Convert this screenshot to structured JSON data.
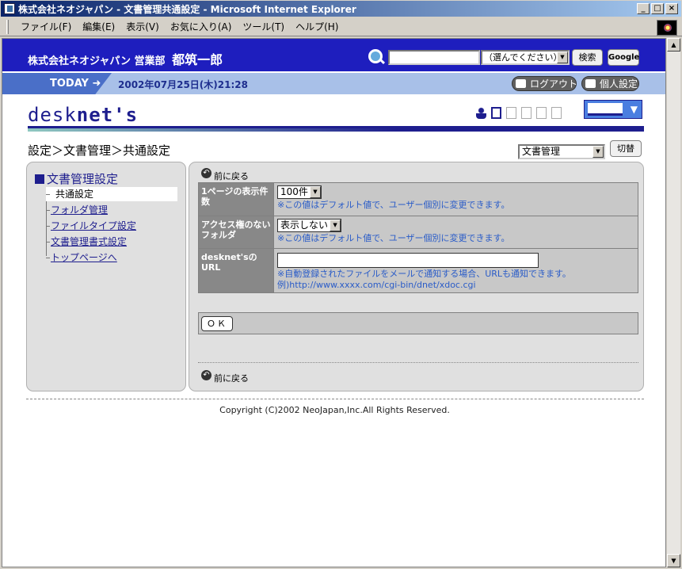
{
  "window": {
    "title": "株式会社ネオジャパン - 文書管理共通設定 - Microsoft Internet Explorer"
  },
  "menu": [
    "ファイル(F)",
    "編集(E)",
    "表示(V)",
    "お気に入り(A)",
    "ツール(T)",
    "ヘルプ(H)"
  ],
  "header": {
    "company": "株式会社ネオジャパン 営業部",
    "user_name": "都筑一郎",
    "search_select": "（選んでください）",
    "search_button": "検索",
    "google_button": "Google",
    "today_label": "TODAY",
    "datetime": "2002年07月25日(木)21:28",
    "logout": "ログアウト",
    "personal_settings": "個人設定",
    "logo_light": "desk",
    "logo_bold": "net's"
  },
  "breadcrumb": "設定＞文書管理＞共通設定",
  "function_select": "文書管理",
  "switch_button": "切替",
  "left_menu": {
    "title": "文書管理設定",
    "items": [
      "共通設定",
      "フォルダ管理",
      "ファイルタイプ設定",
      "文書管理書式設定",
      "トップページへ"
    ]
  },
  "back_link": "前に戻る",
  "settings": {
    "rows": [
      {
        "label": "1ページの表示件数",
        "value": "100件",
        "note": "※この値はデフォルト値で、ユーザー個別に変更できます。"
      },
      {
        "label": "アクセス権のないフォルダ",
        "value": "表示しない",
        "note": "※この値はデフォルト値で、ユーザー個別に変更できます。"
      },
      {
        "label": "desknet'sのURL",
        "value": "",
        "note": "※自動登録されたファイルをメールで通知する場合、URLも通知できます。",
        "example": "例)http://www.xxxx.com/cgi-bin/dnet/xdoc.cgi"
      }
    ]
  },
  "ok_button": "ＯＫ",
  "copyright": "Copyright (C)2002 NeoJapan,Inc.All Rights Reserved."
}
